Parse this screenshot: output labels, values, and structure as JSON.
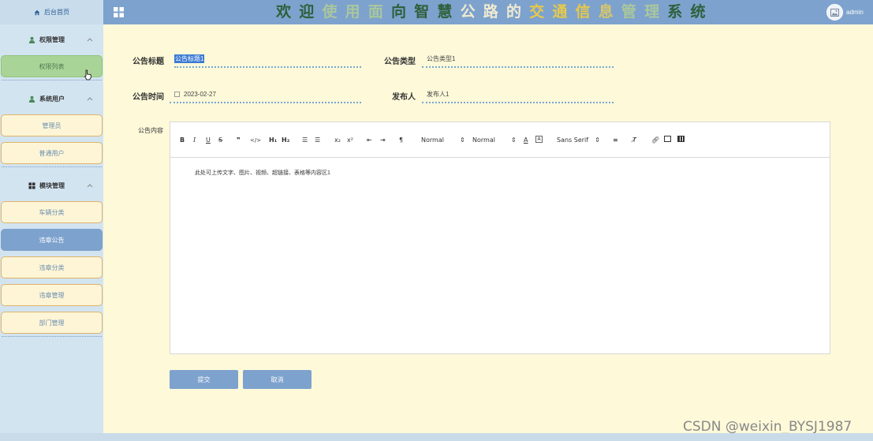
{
  "header": {
    "title_chars": [
      {
        "c": "欢",
        "color": "#2f5f3a"
      },
      {
        "c": "迎",
        "color": "#2f5f3a"
      },
      {
        "c": "使",
        "color": "#a9c79c"
      },
      {
        "c": "用",
        "color": "#a9c79c"
      },
      {
        "c": "面",
        "color": "#a9c79c"
      },
      {
        "c": "向",
        "color": "#2f5f3a"
      },
      {
        "c": "智",
        "color": "#2f5f3a"
      },
      {
        "c": "慧",
        "color": "#2f5f3a"
      },
      {
        "c": "公",
        "color": "#f0ead0"
      },
      {
        "c": "路",
        "color": "#f0ead0"
      },
      {
        "c": "的",
        "color": "#f0ead0"
      },
      {
        "c": "交",
        "color": "#e6c94a"
      },
      {
        "c": "通",
        "color": "#e6c94a"
      },
      {
        "c": "信",
        "color": "#e6c94a"
      },
      {
        "c": "息",
        "color": "#d9c66a"
      },
      {
        "c": "管",
        "color": "#a9c79c"
      },
      {
        "c": "理",
        "color": "#a9c79c"
      },
      {
        "c": "系",
        "color": "#2f5f3a"
      },
      {
        "c": "统",
        "color": "#2f5f3a"
      }
    ],
    "username": "admin",
    "grid_icon": "grid-icon",
    "avatar_icon": "image-icon"
  },
  "sidebar": {
    "home": "后台首页",
    "groups": [
      {
        "title": "权限管理",
        "icon": "user-icon",
        "items": [
          "权限列表"
        ]
      },
      {
        "title": "系统用户",
        "icon": "user-icon",
        "items": [
          "管理员",
          "普通用户"
        ]
      },
      {
        "title": "模块管理",
        "icon": "grid-icon",
        "items": [
          "车辆分类",
          "违章公告",
          "违章分类",
          "违章管理",
          "部门管理"
        ]
      }
    ]
  },
  "form": {
    "title_label": "公告标题",
    "title_value": "公告标题1",
    "type_label": "公告类型",
    "type_value": "公告类型1",
    "time_label": "公告时间",
    "time_value": "2023-02-27",
    "publisher_label": "发布人",
    "publisher_value": "发布人1",
    "content_label": "公告内容",
    "content_value": "此处可上传文字、图片、视频、超链接、表格等内容区1",
    "toolbar": {
      "header_select": "Normal",
      "size_select": "Normal",
      "font_select": "Sans Serif"
    },
    "submit_label": "提交",
    "cancel_label": "取消"
  },
  "watermark": "CSDN @weixin_BYSJ1987",
  "colors": {
    "header_bg": "#7da2cd",
    "sidebar_bg": "#d3e4f1",
    "page_bg": "#fdf9d9",
    "active_item": "#7da2cd",
    "item_border": "#e0b36a"
  }
}
